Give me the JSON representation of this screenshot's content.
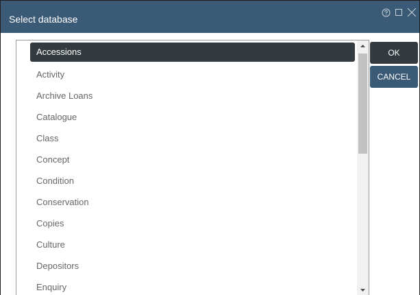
{
  "dialog": {
    "title": "Select database",
    "title_icons": [
      "help-icon",
      "maximize-icon",
      "close-icon"
    ]
  },
  "list": {
    "selected_index": 0,
    "items": [
      {
        "label": "Accessions"
      },
      {
        "label": "Activity"
      },
      {
        "label": "Archive Loans"
      },
      {
        "label": "Catalogue"
      },
      {
        "label": "Class"
      },
      {
        "label": "Concept"
      },
      {
        "label": "Condition"
      },
      {
        "label": "Conservation"
      },
      {
        "label": "Copies"
      },
      {
        "label": "Culture"
      },
      {
        "label": "Depositors"
      },
      {
        "label": "Enquiry"
      }
    ]
  },
  "buttons": {
    "ok_label": "OK",
    "cancel_label": "CANCEL"
  },
  "colors": {
    "titlebar": "#3a5a75",
    "selected_item": "#343b40",
    "ok_button": "#343b40",
    "cancel_button": "#3a5a75"
  }
}
